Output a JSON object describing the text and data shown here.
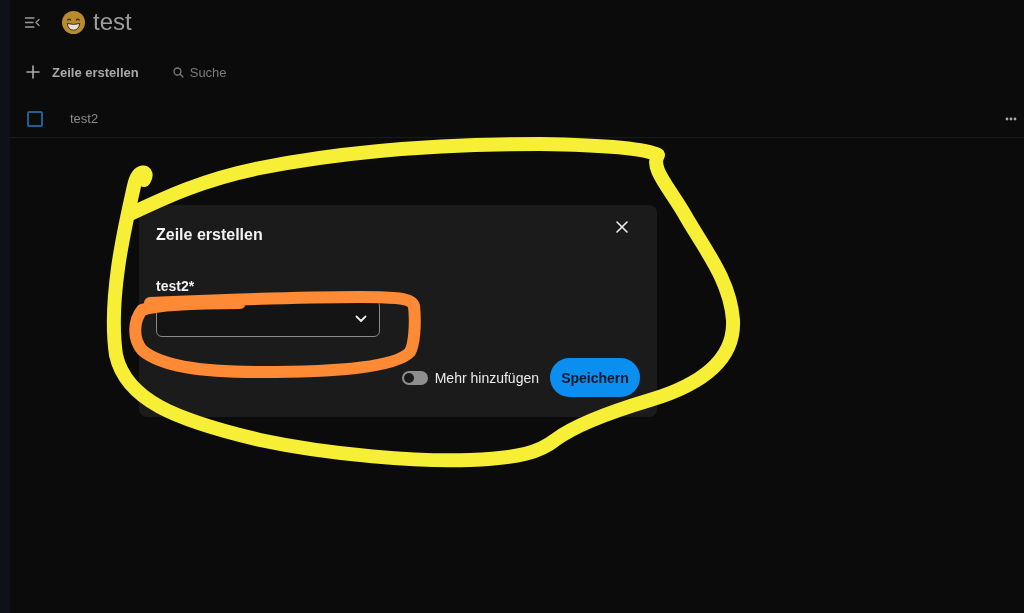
{
  "header": {
    "title": "test"
  },
  "toolbar": {
    "create_button": "Zeile erstellen",
    "search": {
      "placeholder": "Suche"
    }
  },
  "table": {
    "rows": [
      {
        "cells": [
          "test2"
        ],
        "checked": false
      }
    ]
  },
  "dialog": {
    "title": "Zeile erstellen",
    "fields": [
      {
        "kind": "select",
        "label": "test2*"
      }
    ],
    "toggle": {
      "label": "Mehr hinzufügen",
      "on": false
    },
    "save_button": "Speichern"
  },
  "annotations": [
    {
      "kind": "loop",
      "color": "#f7ef36"
    },
    {
      "kind": "loop",
      "color": "#ff8a35"
    }
  ]
}
